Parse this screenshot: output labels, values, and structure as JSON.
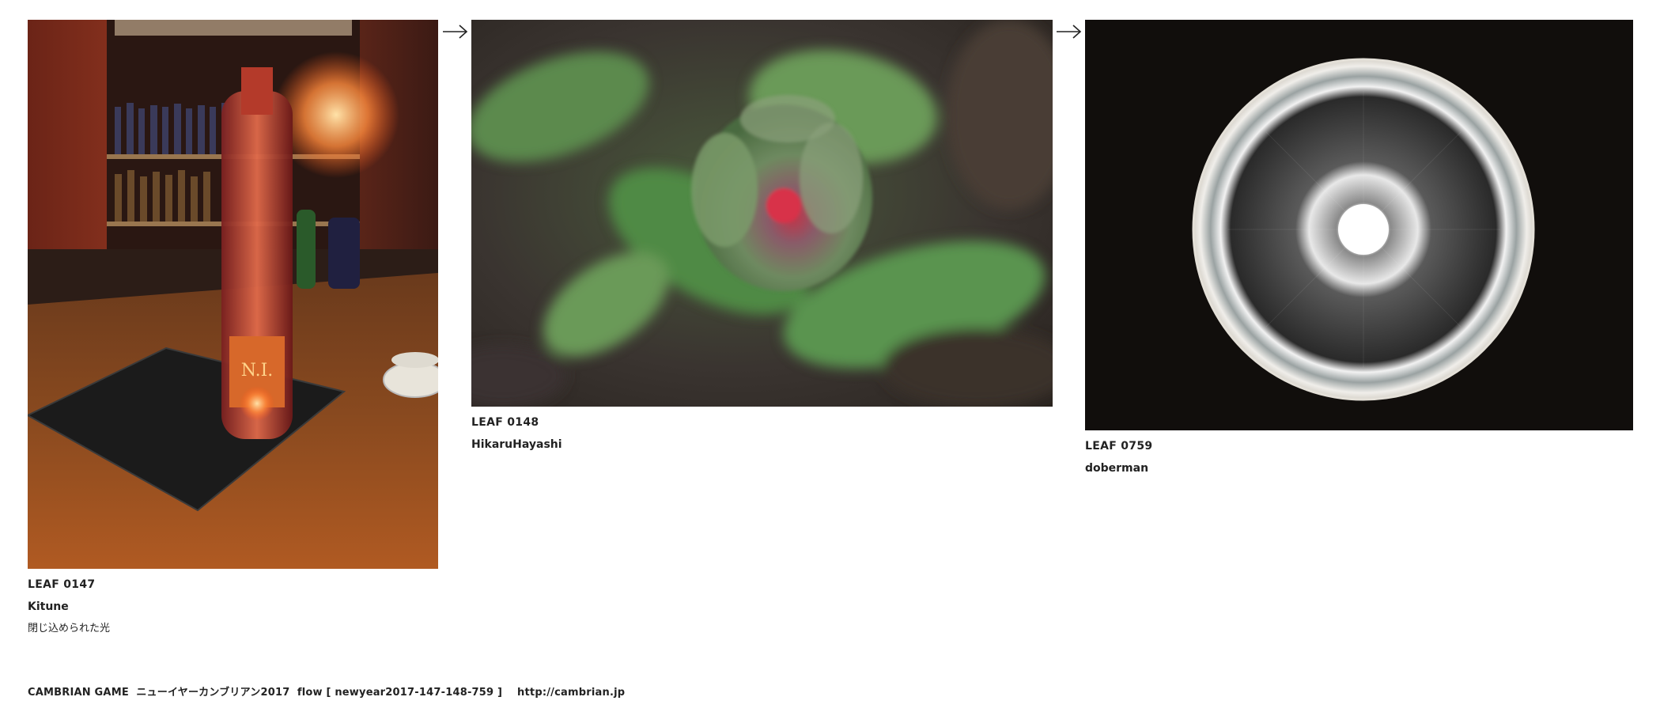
{
  "leaves": [
    {
      "id": "LEAF 0147",
      "author": "Kitune",
      "caption": "閉じ込められた光",
      "image": "bar-counter-bottle-photo"
    },
    {
      "id": "LEAF 0148",
      "author": "HikaruHayashi",
      "image": "tulip-bud-photo"
    },
    {
      "id": "LEAF 0759",
      "author": "doberman",
      "image": "glowing-ring-lamp-photo"
    }
  ],
  "footer": {
    "text": "CAMBRIAN GAME  ニューイヤーカンブリアン2017  flow [ newyear2017-147-148-759 ]    http://cambrian.jp"
  },
  "colors": {
    "background": "#ffffff",
    "text": "#222222",
    "arrow": "#222222"
  }
}
